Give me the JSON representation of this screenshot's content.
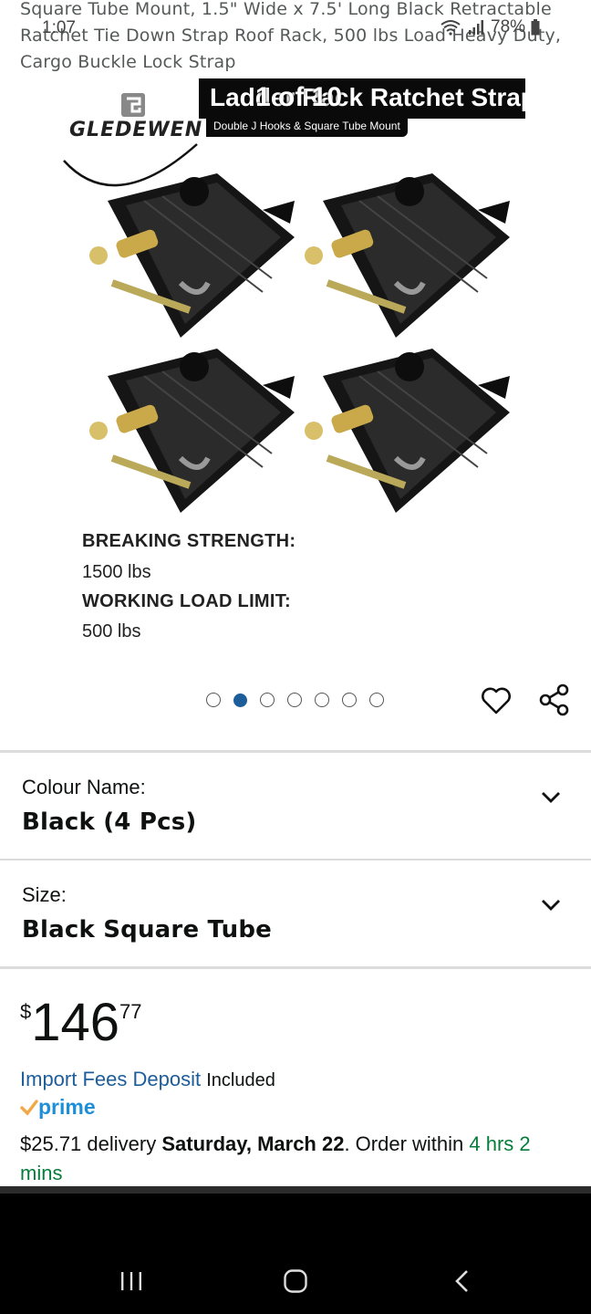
{
  "status_bar": {
    "time": "1:07",
    "battery": "78%"
  },
  "product": {
    "title": "Square Tube Mount, 1.5\" Wide x 7.5' Long Black Retractable Ratchet Tie Down Strap Roof Rack, 500 lbs Load Heavy Duty, Cargo Buckle Lock Strap"
  },
  "image": {
    "brand": "GLEDEWEN",
    "banner_title": "Ladder Rack Ratchet Straps",
    "banner_subtitle": "Double J Hooks & Square Tube Mount",
    "counter": "1 of 10",
    "specs": [
      {
        "heading": "BREAKING STRENGTH:",
        "value": "1500 lbs"
      },
      {
        "heading": "WORKING LOAD LIMIT:",
        "value": "500 lbs"
      }
    ],
    "dot_count": 7,
    "active_dot": 1
  },
  "variations": {
    "colour": {
      "label": "Colour Name:",
      "value": "Black (4 Pcs)"
    },
    "size": {
      "label": "Size:",
      "value": "Black Square Tube"
    }
  },
  "price": {
    "symbol": "$",
    "whole": "146",
    "fraction": "77"
  },
  "import": {
    "link": "Import Fees Deposit",
    "suffix": "Included"
  },
  "prime": {
    "label": "prime"
  },
  "delivery": {
    "prefix": "$25.71 delivery ",
    "date": "Saturday, March 22",
    "middle": ". Order within ",
    "countdown": "4 hrs 2 mins"
  },
  "colors": {
    "link": "#1d5d9a",
    "prime": "#1d8fd9",
    "green": "#067d3a"
  }
}
